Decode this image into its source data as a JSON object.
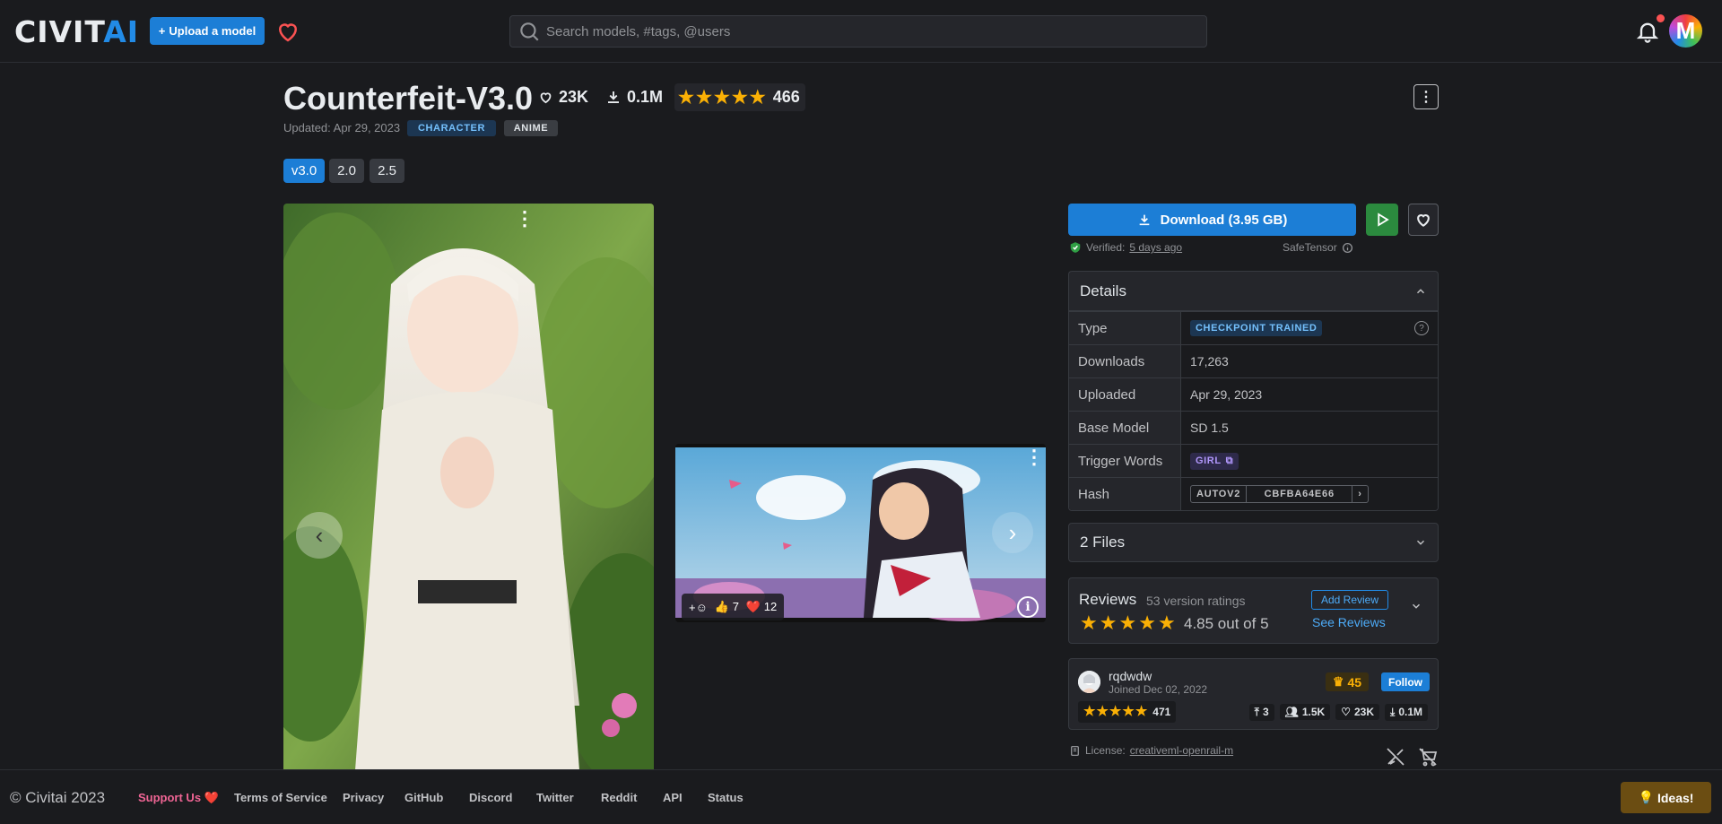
{
  "header": {
    "logo": "CIVIT",
    "logo_ai": "AI",
    "upload_label": "Upload a model",
    "search_placeholder": "Search models, #tags, @users",
    "avatar_initial": "M"
  },
  "model": {
    "title": "Counterfeit-V3.0",
    "likes": "23K",
    "downloads": "0.1M",
    "rating_count": "466",
    "updated": "Updated: Apr 29, 2023",
    "tags": [
      "CHARACTER",
      "ANIME"
    ],
    "versions": [
      "v3.0",
      "2.0",
      "2.5"
    ]
  },
  "gallery": {
    "reaction_thumbs": "7",
    "reaction_hearts": "12"
  },
  "actions": {
    "download_label": "Download (3.95 GB)",
    "verified_label": "Verified:",
    "verified_time": "5 days ago",
    "format": "SafeTensor"
  },
  "details": {
    "title": "Details",
    "rows": [
      {
        "key": "Type",
        "value": "CHECKPOINT TRAINED"
      },
      {
        "key": "Downloads",
        "value": "17,263"
      },
      {
        "key": "Uploaded",
        "value": "Apr 29, 2023"
      },
      {
        "key": "Base Model",
        "value": "SD 1.5"
      },
      {
        "key": "Trigger Words",
        "value": "GIRL"
      },
      {
        "key": "Hash",
        "value": "AUTOV2",
        "hash": "CBFBA64E66"
      }
    ]
  },
  "files": {
    "label": "2 Files"
  },
  "reviews": {
    "title": "Reviews",
    "count_label": "53 version ratings",
    "score_label": "4.85 out of 5",
    "add_label": "Add Review",
    "see_label": "See Reviews"
  },
  "creator": {
    "name": "rqdwdw",
    "joined": "Joined Dec 02, 2022",
    "rank": "45",
    "follow_label": "Follow",
    "rating_count": "471",
    "uploads": "3",
    "followers": "1.5K",
    "likes": "23K",
    "downloads": "0.1M"
  },
  "license": {
    "label": "License:",
    "name": "creativeml-openrail-m"
  },
  "footer": {
    "copyright": "© Civitai 2023",
    "links": [
      "Support Us ❤️",
      "Terms of Service",
      "Privacy",
      "GitHub",
      "Discord",
      "Twitter",
      "Reddit",
      "API",
      "Status"
    ],
    "ideas_label": "Ideas!"
  },
  "colors": {
    "accent": "#1c7ed6",
    "star": "#fab005",
    "run": "#2b8a3e",
    "support": "#f06595"
  }
}
